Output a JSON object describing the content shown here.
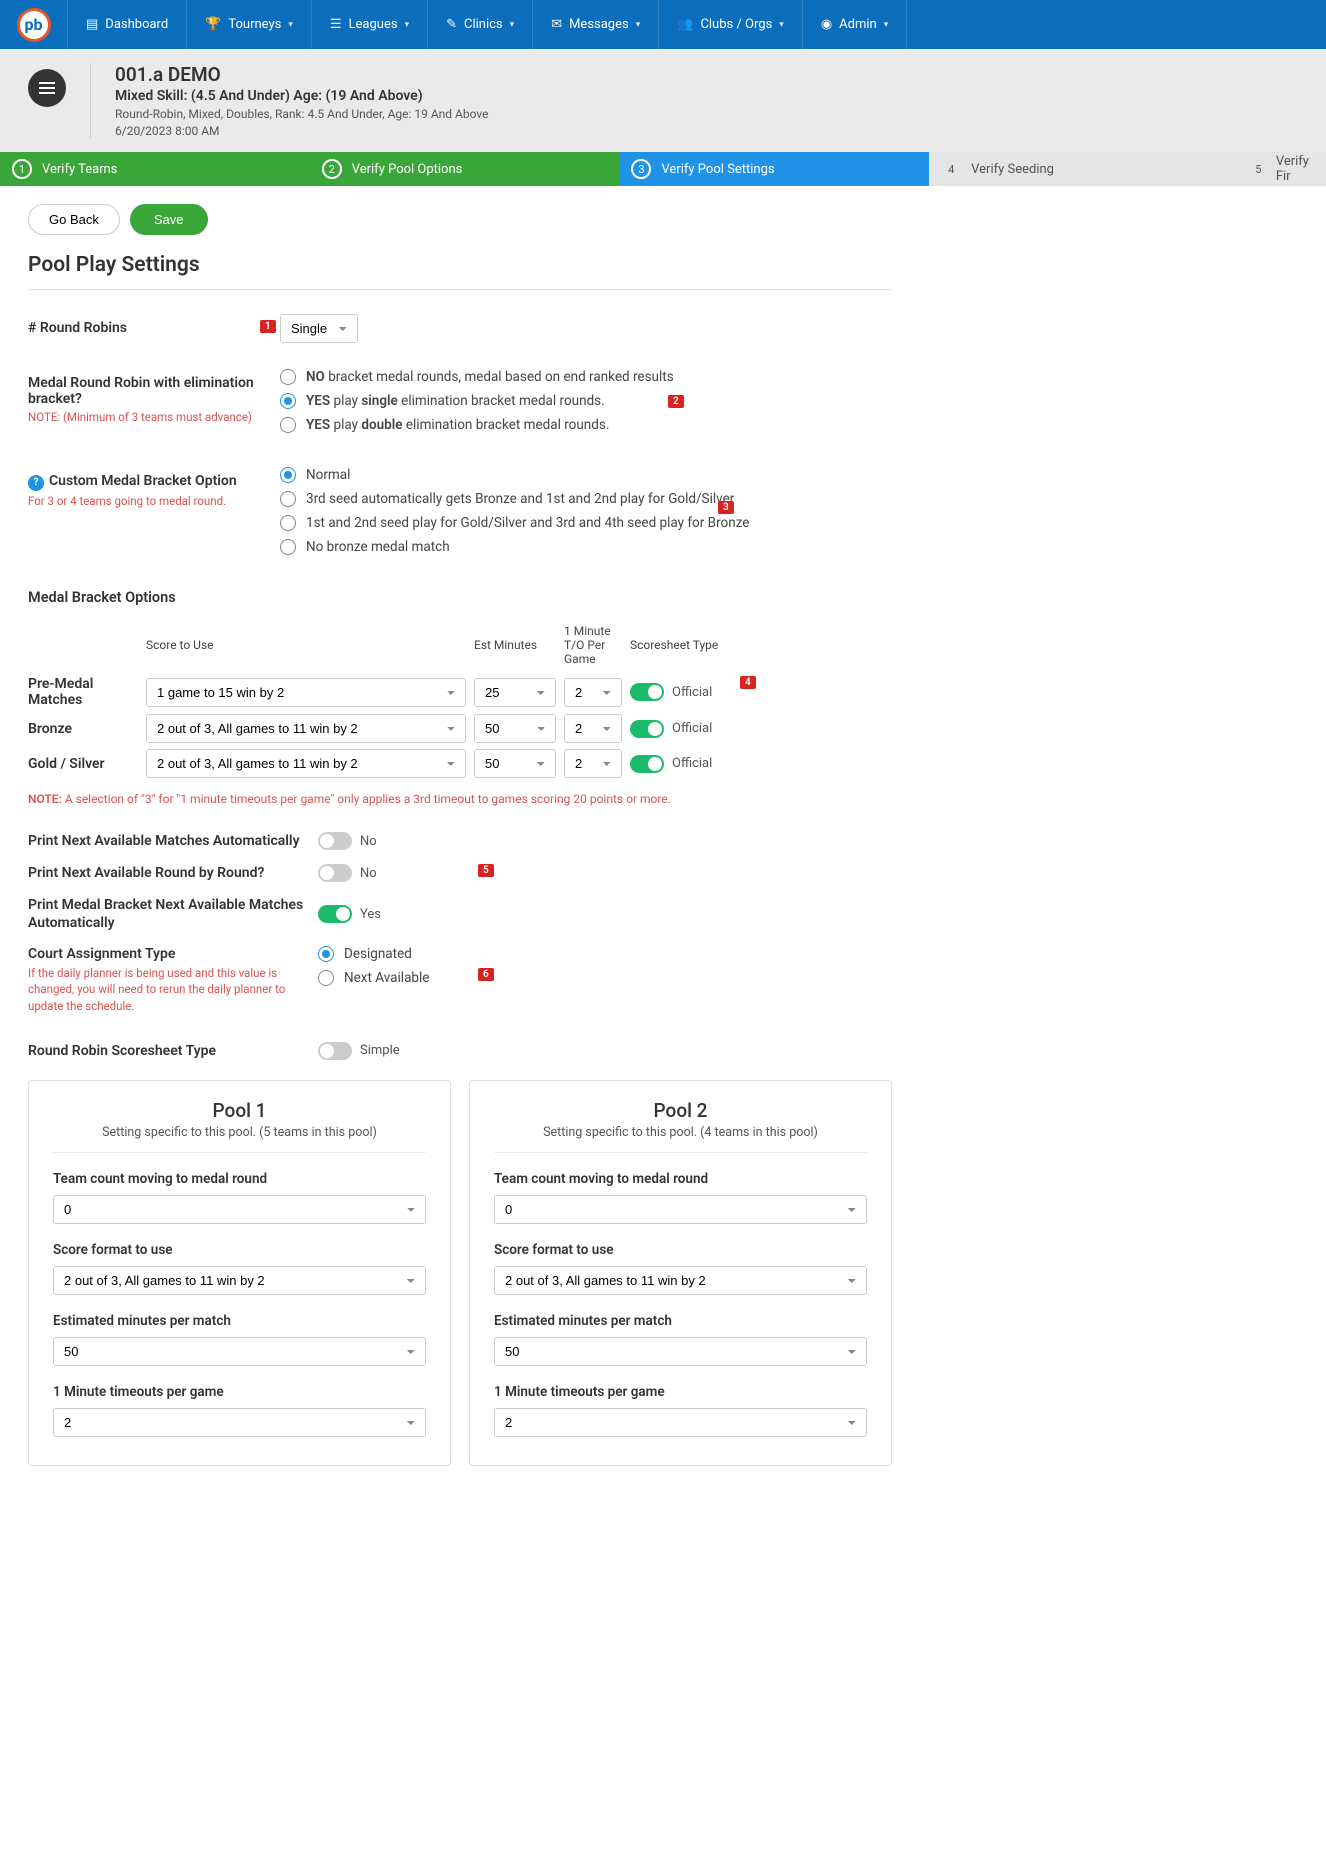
{
  "nav": {
    "items": [
      {
        "label": "Dashboard"
      },
      {
        "label": "Tourneys"
      },
      {
        "label": "Leagues"
      },
      {
        "label": "Clinics"
      },
      {
        "label": "Messages"
      },
      {
        "label": "Clubs / Orgs"
      },
      {
        "label": "Admin"
      }
    ]
  },
  "event": {
    "title": "001.a DEMO",
    "subtitle": "Mixed Skill: (4.5 And Under) Age: (19 And Above)",
    "details": "Round-Robin, Mixed, Doubles, Rank: 4.5 And Under, Age: 19 And Above",
    "datetime": "6/20/2023 8:00 AM"
  },
  "steps": [
    {
      "num": "1",
      "label": "Verify Teams",
      "state": "done"
    },
    {
      "num": "2",
      "label": "Verify Pool Options",
      "state": "done"
    },
    {
      "num": "3",
      "label": "Verify Pool Settings",
      "state": "active"
    },
    {
      "num": "4",
      "label": "Verify Seeding",
      "state": "pending"
    },
    {
      "num": "5",
      "label": "Verify Fir",
      "state": "pending"
    }
  ],
  "buttons": {
    "go_back": "Go Back",
    "save": "Save"
  },
  "page_title": "Pool Play Settings",
  "round_robins": {
    "label": "# Round Robins",
    "value": "Single"
  },
  "medal_rr": {
    "label": "Medal Round Robin with elimination bracket?",
    "note": "NOTE: (Minimum of 3 teams must advance)",
    "opt_no_pre": "NO",
    "opt_no_rest": " bracket medal rounds, medal based on end ranked results",
    "opt_yes1_pre": "YES",
    "opt_yes1_mid": " play ",
    "opt_yes1_bold": "single",
    "opt_yes1_rest": " elimination bracket medal rounds.",
    "opt_yes2_pre": "YES",
    "opt_yes2_mid": " play ",
    "opt_yes2_bold": "double",
    "opt_yes2_rest": " elimination bracket medal rounds."
  },
  "custom_bracket": {
    "label": "Custom Medal Bracket Option",
    "note": "For 3 or 4 teams going to medal round.",
    "opt1": "Normal",
    "opt2": "3rd seed automatically gets Bronze and 1st and 2nd play for Gold/Silver",
    "opt3": "1st and 2nd seed play for Gold/Silver and 3rd and 4th seed play for Bronze",
    "opt4": "No bronze medal match"
  },
  "medal_bracket": {
    "title": "Medal Bracket Options",
    "headers": {
      "score": "Score to Use",
      "est": "Est Minutes",
      "to": "1 Minute T/O Per Game",
      "ss": "Scoresheet Type"
    },
    "rows": [
      {
        "label": "Pre-Medal Matches",
        "score": "1 game to 15 win by 2",
        "est": "25",
        "to": "2",
        "ss": "Official"
      },
      {
        "label": "Bronze",
        "score": "2 out of 3, All games to 11 win by 2",
        "est": "50",
        "to": "2",
        "ss": "Official"
      },
      {
        "label": "Gold / Silver",
        "score": "2 out of 3, All games to 11 win by 2",
        "est": "50",
        "to": "2",
        "ss": "Official"
      }
    ],
    "note_pre": "NOTE:",
    "note": " A selection of \"3\" for \"1 minute timeouts per game\" only applies a 3rd timeout to games scoring 20 points or more."
  },
  "print": {
    "r1": "Print Next Available Matches Automatically",
    "r1v": "No",
    "r2": "Print Next Available Round by Round?",
    "r2v": "No",
    "r3": "Print Medal Bracket Next Available Matches Automatically",
    "r3v": "Yes"
  },
  "court": {
    "label": "Court Assignment Type",
    "note": "If the daily planner is being used and this value is changed, you will need to rerun the daily planner to update the schedule.",
    "opt1": "Designated",
    "opt2": "Next Available"
  },
  "rr_ss": {
    "label": "Round Robin Scoresheet Type",
    "value": "Simple"
  },
  "pools": [
    {
      "title": "Pool 1",
      "sub": "Setting specific to this pool. (5 teams in this pool)",
      "team_count_label": "Team count moving to medal round",
      "team_count": "0",
      "score_label": "Score format to use",
      "score": "2 out of 3, All games to 11 win by 2",
      "est_label": "Estimated minutes per match",
      "est": "50",
      "to_label": "1 Minute timeouts per game",
      "to": "2"
    },
    {
      "title": "Pool 2",
      "sub": "Setting specific to this pool. (4 teams in this pool)",
      "team_count_label": "Team count moving to medal round",
      "team_count": "0",
      "score_label": "Score format to use",
      "score": "2 out of 3, All games to 11 win by 2",
      "est_label": "Estimated minutes per match",
      "est": "50",
      "to_label": "1 Minute timeouts per game",
      "to": "2"
    }
  ],
  "badges": {
    "b1": "1",
    "b2": "2",
    "b3": "3",
    "b4": "4",
    "b5": "5",
    "b6": "6"
  }
}
